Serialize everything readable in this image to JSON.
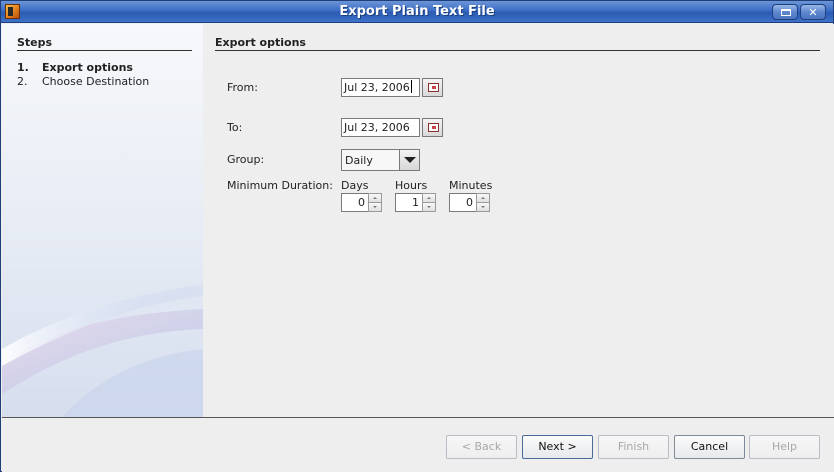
{
  "window": {
    "title": "Export Plain Text File"
  },
  "steps": {
    "title": "Steps",
    "items": [
      {
        "num": "1.",
        "label": "Export options",
        "active": true
      },
      {
        "num": "2.",
        "label": "Choose Destination",
        "active": false
      }
    ]
  },
  "content": {
    "section_title": "Export options",
    "from_label": "From:",
    "from_value": "Jul 23, 2006",
    "to_label": "To:",
    "to_value": "Jul 23, 2006",
    "group_label": "Group:",
    "group_value": "Daily",
    "min_duration_label": "Minimum Duration:",
    "days_label": "Days",
    "days_value": "0",
    "hours_label": "Hours",
    "hours_value": "1",
    "minutes_label": "Minutes",
    "minutes_value": "0"
  },
  "buttons": {
    "back": "< Back",
    "next": "Next >",
    "finish": "Finish",
    "cancel": "Cancel",
    "help": "Help"
  },
  "icons": {
    "app": "app-icon",
    "maximize": "maximize-icon",
    "close": "close-icon",
    "calendar": "calendar-icon",
    "dropdown": "chevron-down-icon"
  },
  "colors": {
    "titlebar": "#3c6ec6",
    "panel_bg": "#eeeeee",
    "disabled_text": "#a8a8a8"
  }
}
